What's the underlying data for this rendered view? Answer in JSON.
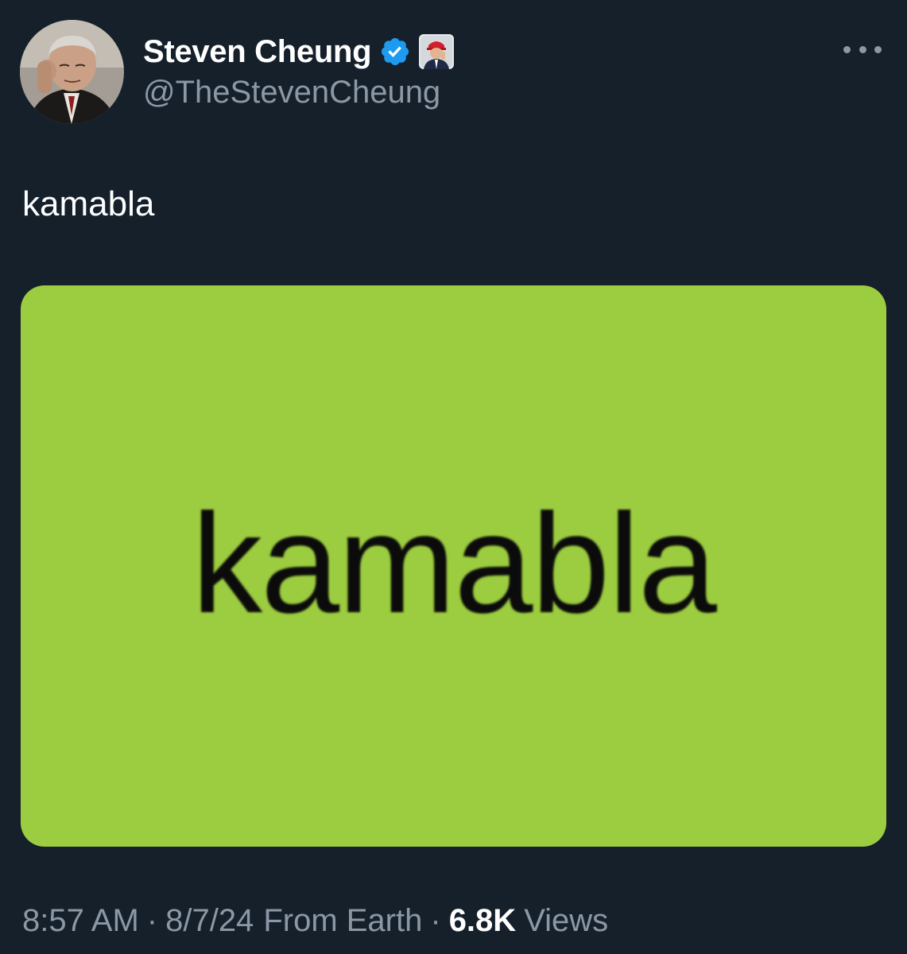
{
  "author": {
    "display_name": "Steven Cheung",
    "handle": "@TheStevenCheung",
    "verified_icon": "verified-badge-icon",
    "affiliate_icon": "affiliate-badge-icon",
    "avatar_icon": "profile-photo"
  },
  "tweet": {
    "text": "kamabla",
    "media_text": "kamabla",
    "media_background": "#9ccc3f"
  },
  "meta": {
    "time": "8:57 AM",
    "separator": "·",
    "date": "8/7/24",
    "source": "From Earth",
    "views_count": "6.8K",
    "views_label": "Views"
  },
  "colors": {
    "background": "#15202b",
    "secondary_text": "#8b98a5",
    "verified_blue": "#1d9bf0"
  }
}
